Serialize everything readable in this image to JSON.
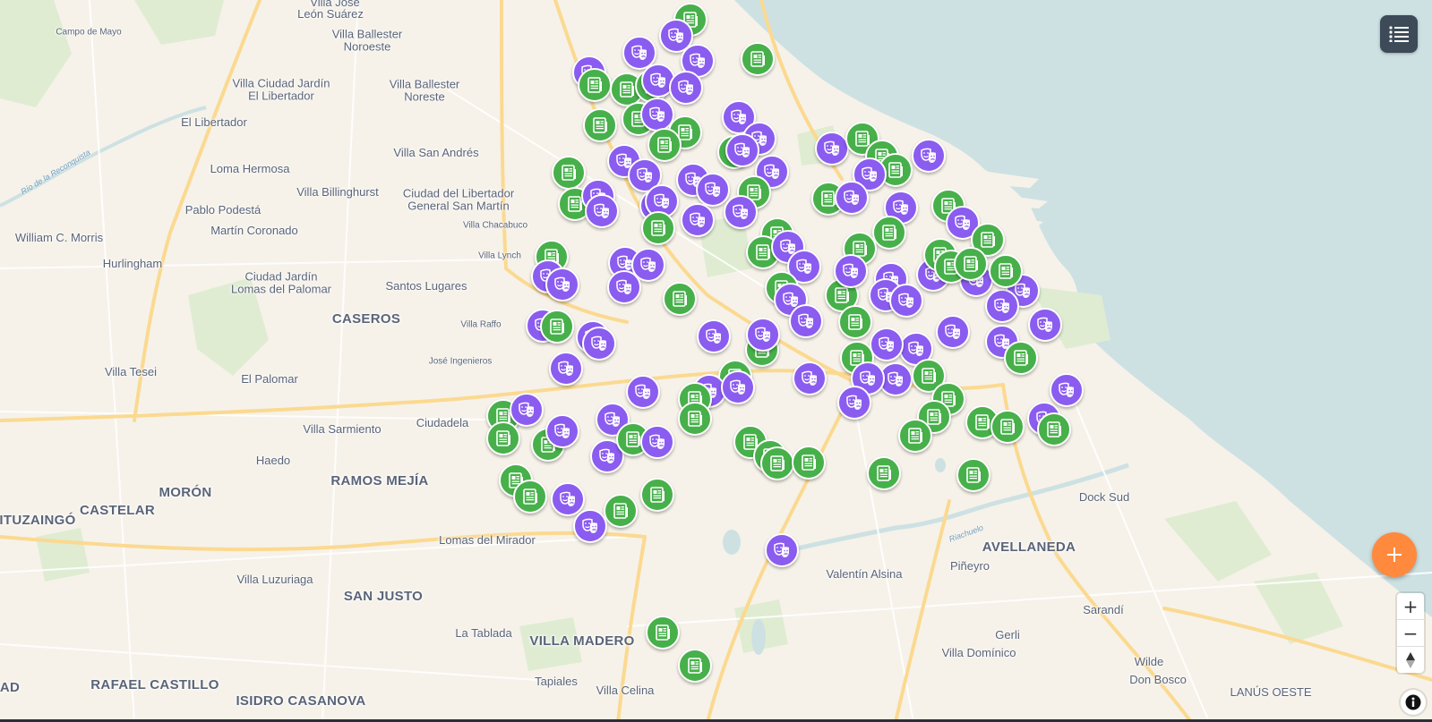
{
  "colors": {
    "water": "#cde1e3",
    "land": "#f6f2e9",
    "park": "#dfecd2",
    "road": "#fbd990",
    "road_minor": "#ffffff",
    "marker_green": "#47b04a",
    "marker_purple": "#8b5cf0",
    "fab": "#ff8a3d",
    "menu_bg": "#3d4a57"
  },
  "map": {
    "places": [
      {
        "id": "p1",
        "text": "Villa José",
        "size": "m"
      },
      {
        "id": "p2",
        "text": "León Suárez",
        "size": "m"
      },
      {
        "id": "p3",
        "text": "Campo de Mayo",
        "size": "s"
      },
      {
        "id": "p4",
        "text": "Villa Ballester\nNoroeste",
        "size": "m"
      },
      {
        "id": "p5",
        "text": "Villa Ciudad Jardín\nEl Libertador",
        "size": "m"
      },
      {
        "id": "p6",
        "text": "Villa Ballester\nNoreste",
        "size": "m"
      },
      {
        "id": "p7",
        "text": "El Libertador",
        "size": "m"
      },
      {
        "id": "p8",
        "text": "Villa San Andrés",
        "size": "m"
      },
      {
        "id": "p9",
        "text": "Loma Hermosa",
        "size": "m"
      },
      {
        "id": "p10",
        "text": "Villa Billinghurst",
        "size": "m"
      },
      {
        "id": "p11",
        "text": "Ciudad del Libertador\nGeneral San Martín",
        "size": "m"
      },
      {
        "id": "p12",
        "text": "Pablo Podestá",
        "size": "m"
      },
      {
        "id": "p13",
        "text": "Villa Chacabuco",
        "size": "s"
      },
      {
        "id": "p14",
        "text": "William C. Morris",
        "size": "m"
      },
      {
        "id": "p15",
        "text": "Martín Coronado",
        "size": "m"
      },
      {
        "id": "p16",
        "text": "Hurlingham",
        "size": "m"
      },
      {
        "id": "p17",
        "text": "Villa Lynch",
        "size": "s"
      },
      {
        "id": "p18",
        "text": "Ciudad Jardín\nLomas del Palomar",
        "size": "m"
      },
      {
        "id": "p19",
        "text": "Santos Lugares",
        "size": "m"
      },
      {
        "id": "p20",
        "text": "CASEROS",
        "size": "l"
      },
      {
        "id": "p21",
        "text": "Villa Raffo",
        "size": "s"
      },
      {
        "id": "p22",
        "text": "José Ingenieros",
        "size": "s"
      },
      {
        "id": "p23",
        "text": "Villa Tesei",
        "size": "m"
      },
      {
        "id": "p24",
        "text": "El Palomar",
        "size": "m"
      },
      {
        "id": "p25",
        "text": "Ciudadela",
        "size": "m"
      },
      {
        "id": "p26",
        "text": "Villa Sarmiento",
        "size": "m"
      },
      {
        "id": "p27",
        "text": "Haedo",
        "size": "m"
      },
      {
        "id": "p28",
        "text": "RAMOS MEJÍA",
        "size": "l"
      },
      {
        "id": "p29",
        "text": "MORÓN",
        "size": "l"
      },
      {
        "id": "p30",
        "text": "CASTELAR",
        "size": "l"
      },
      {
        "id": "p31",
        "text": "ITUZAINGÓ",
        "size": "l"
      },
      {
        "id": "p32",
        "text": "Lomas del Mirador",
        "size": "m"
      },
      {
        "id": "p33",
        "text": "Villa Luzuriaga",
        "size": "m"
      },
      {
        "id": "p34",
        "text": "SAN JUSTO",
        "size": "l"
      },
      {
        "id": "p35",
        "text": "La Tablada",
        "size": "m"
      },
      {
        "id": "p36",
        "text": "VILLA MADERO",
        "size": "l"
      },
      {
        "id": "p37",
        "text": "RAFAEL CASTILLO",
        "size": "l"
      },
      {
        "id": "p38",
        "text": "ISIDRO CASANOVA",
        "size": "l"
      },
      {
        "id": "p39",
        "text": "Tapiales",
        "size": "m"
      },
      {
        "id": "p40",
        "text": "Villa Celina",
        "size": "m"
      },
      {
        "id": "p41",
        "text": "AD",
        "size": "l"
      },
      {
        "id": "p42",
        "text": "Valentín Alsina",
        "size": "m"
      },
      {
        "id": "p43",
        "text": "Piñeyro",
        "size": "m"
      },
      {
        "id": "p44",
        "text": "AVELLANEDA",
        "size": "l"
      },
      {
        "id": "p45",
        "text": "Dock Sud",
        "size": "m"
      },
      {
        "id": "p46",
        "text": "Sarandí",
        "size": "m"
      },
      {
        "id": "p47",
        "text": "Gerli",
        "size": "m"
      },
      {
        "id": "p48",
        "text": "Villa Domínico",
        "size": "m"
      },
      {
        "id": "p49",
        "text": "Wilde",
        "size": "m"
      },
      {
        "id": "p50",
        "text": "Don Bosco",
        "size": "m"
      },
      {
        "id": "p51",
        "text": "LANÚS OESTE",
        "size": "l"
      }
    ],
    "rivers": [
      {
        "id": "r1",
        "text": "Río de la Reconquista"
      },
      {
        "id": "r2",
        "text": "Riachuelo"
      }
    ],
    "green_icon": "newspaper-icon",
    "purple_icon": "theater-masks-icon"
  },
  "controls": {
    "menu_icon": "list-icon",
    "add_icon": "plus-icon",
    "zoom_in": "+",
    "zoom_out": "−",
    "compass": "compass-icon",
    "info_icon": "info-icon"
  }
}
